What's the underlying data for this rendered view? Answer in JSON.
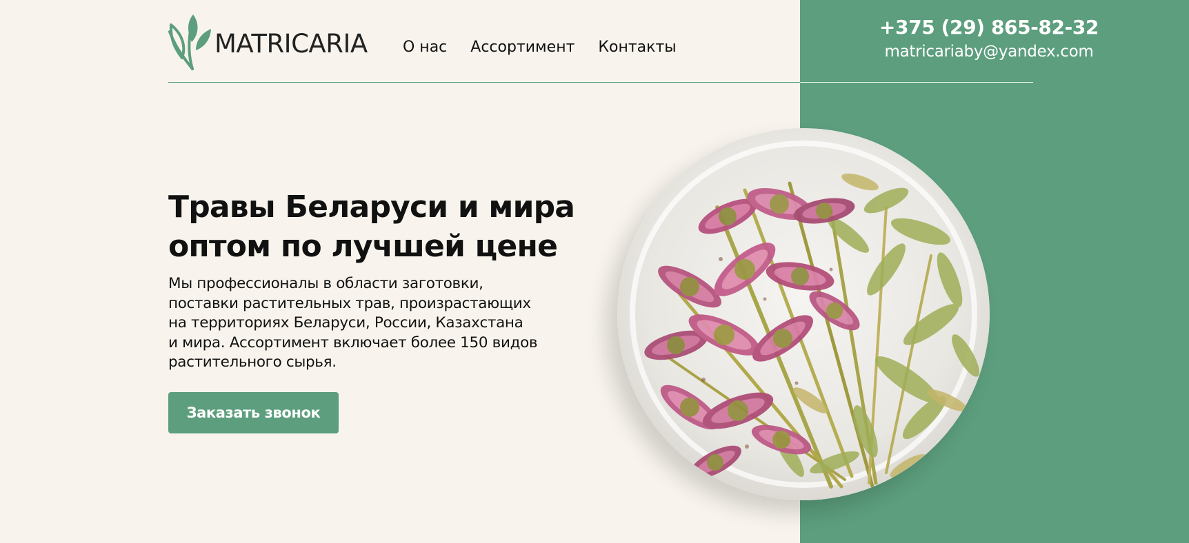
{
  "brand": {
    "name": "MATRICARIA"
  },
  "nav": {
    "items": [
      {
        "label": "О нас"
      },
      {
        "label": "Ассортимент"
      },
      {
        "label": "Контакты"
      }
    ]
  },
  "contact": {
    "phone": "+375 (29) 865-82-32",
    "email": "matricariaby@yandex.com"
  },
  "hero": {
    "title_line_1": "Травы Беларуси и мира",
    "title_line_2": "оптом по лучшей цене",
    "description_line_1": "Мы профессионалы в области заготовки,",
    "description_line_2": "поставки растительных трав, произрастающих",
    "description_line_3": "на территориях Беларуси, России, Казахстана",
    "description_line_4": "и мира. Ассортимент включает более 150 видов",
    "description_line_5": "растительного сырья.",
    "button_label": "Заказать звонок"
  },
  "colors": {
    "background": "#f8f4ed",
    "accent": "#5c9e7d",
    "text": "#111111",
    "white": "#ffffff"
  },
  "icons": {
    "logo": "leaf-logo-icon",
    "image": "dried-herbs-plate-image"
  }
}
